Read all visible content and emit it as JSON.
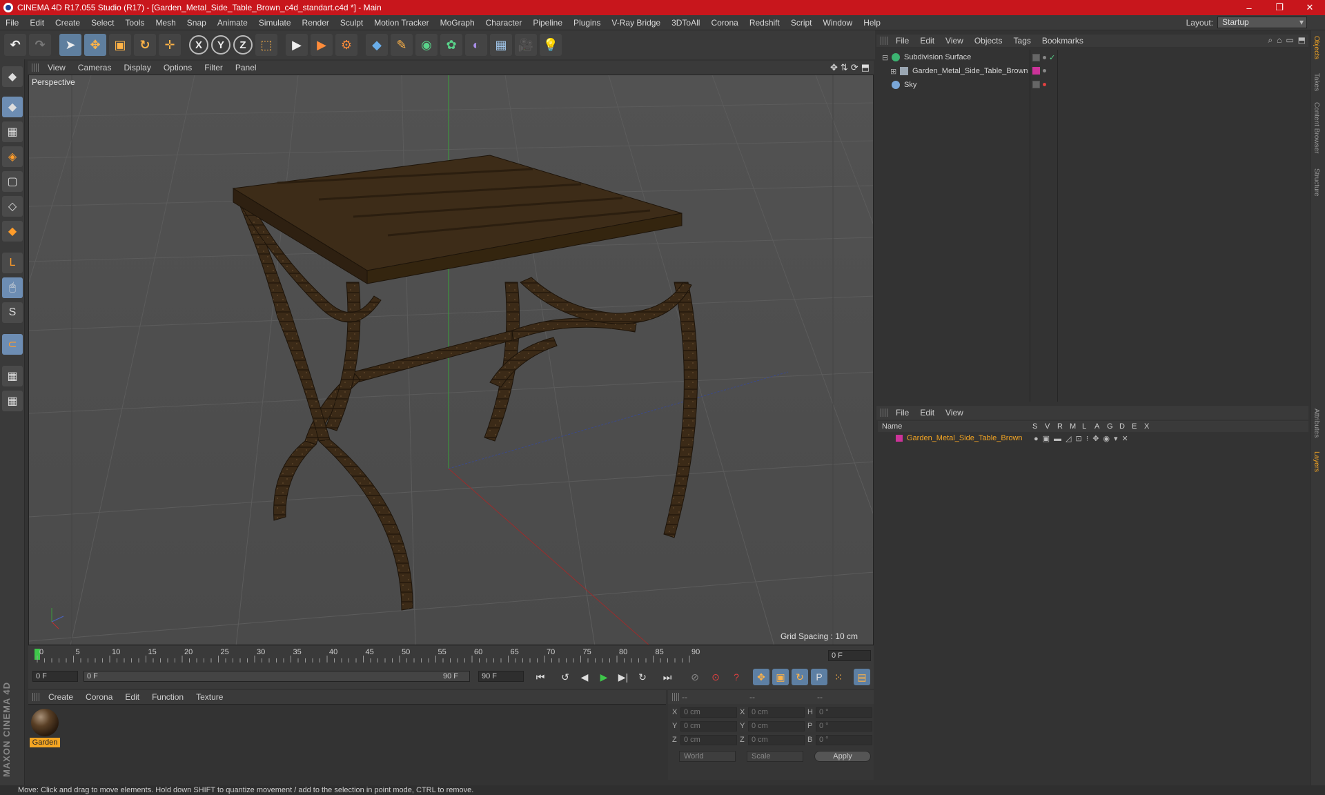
{
  "window": {
    "title": "CINEMA 4D R17.055 Studio (R17) - [Garden_Metal_Side_Table_Brown_c4d_standart.c4d *] - Main",
    "minimize": "–",
    "maximize": "❐",
    "close": "✕"
  },
  "menu": [
    "File",
    "Edit",
    "Create",
    "Select",
    "Tools",
    "Mesh",
    "Snap",
    "Animate",
    "Simulate",
    "Render",
    "Sculpt",
    "Motion Tracker",
    "MoGraph",
    "Character",
    "Pipeline",
    "Plugins",
    "V-Ray Bridge",
    "3DToAll",
    "Corona",
    "Redshift",
    "Script",
    "Window",
    "Help"
  ],
  "layout": {
    "label": "Layout:",
    "value": "Startup"
  },
  "toolbar": {
    "undo": "↶",
    "redo": "↷",
    "select": "➤",
    "move": "✥",
    "scale": "▣",
    "rotate": "↻",
    "move2": "✛",
    "x_lock": "X",
    "y_lock": "Y",
    "z_lock": "Z",
    "coord": "⬚",
    "render_view": "▶",
    "render_pic": "▶",
    "render_settings": "⚙",
    "cube": "◆",
    "pen": "✎",
    "subdiv": "◉",
    "array": "✿",
    "deformer": "◐",
    "floor": "▦",
    "camera": "🎥",
    "light": "💡"
  },
  "viewport": {
    "menu": [
      "View",
      "Cameras",
      "Display",
      "Options",
      "Filter",
      "Panel"
    ],
    "label": "Perspective",
    "grid_spacing": "Grid Spacing : 10 cm",
    "nav_icons": [
      "✥",
      "⇅",
      "⟳",
      "⬒"
    ]
  },
  "timeline": {
    "ticks": [
      "0",
      "5",
      "10",
      "15",
      "20",
      "25",
      "30",
      "35",
      "40",
      "45",
      "50",
      "55",
      "60",
      "65",
      "70",
      "75",
      "80",
      "85",
      "90"
    ],
    "current_frame": "0 F",
    "start": "0 F",
    "range_start": "0 F",
    "range_end": "90 F",
    "end": "90 F"
  },
  "transport": [
    "⏮",
    "↺",
    "◀",
    "▶",
    "▶|",
    "↻",
    "⏭"
  ],
  "material_manager": {
    "menu": [
      "Create",
      "Corona",
      "Edit",
      "Function",
      "Texture"
    ],
    "materials": [
      {
        "name": "Garden"
      }
    ]
  },
  "coordinates": {
    "header": [
      "--",
      "--",
      "--"
    ],
    "rows": [
      {
        "a": "X",
        "av": "0 cm",
        "b": "X",
        "bv": "0 cm",
        "c": "H",
        "cv": "0 °"
      },
      {
        "a": "Y",
        "av": "0 cm",
        "b": "Y",
        "bv": "0 cm",
        "c": "P",
        "cv": "0 °"
      },
      {
        "a": "Z",
        "av": "0 cm",
        "b": "Z",
        "bv": "0 cm",
        "c": "B",
        "cv": "0 °"
      }
    ],
    "space": "World",
    "mode": "Scale",
    "apply": "Apply"
  },
  "object_manager": {
    "menu": [
      "File",
      "Edit",
      "View",
      "Objects",
      "Tags",
      "Bookmarks"
    ],
    "objects": [
      {
        "name": "Subdivision Surface",
        "icon_color": "#3cb371"
      },
      {
        "name": "Garden_Metal_Side_Table_Brown",
        "icon_color": "#9aa6b2"
      },
      {
        "name": "Sky",
        "icon_color": "#7aa7d8"
      }
    ]
  },
  "layer_manager": {
    "menu": [
      "File",
      "Edit",
      "View"
    ],
    "columns": [
      "Name",
      "S",
      "V",
      "R",
      "M",
      "L",
      "A",
      "G",
      "D",
      "E",
      "X"
    ],
    "layers": [
      {
        "name": "Garden_Metal_Side_Table_Brown",
        "color": "#cc3399"
      }
    ]
  },
  "right_tabs": [
    "Objects",
    "Takes",
    "Content Browser",
    "Structure",
    "Attributes",
    "Layers"
  ],
  "left_tools": [
    "◆",
    "▦",
    "◈",
    "▢",
    "◇",
    "◆",
    "L",
    "🖱",
    "S",
    "⊂",
    "▦",
    "▦"
  ],
  "brand": "MAXON CINEMA 4D",
  "status": "Move: Click and drag to move elements. Hold down SHIFT to quantize movement / add to the selection in point mode, CTRL to remove.",
  "colors": {
    "title_bar": "#c8161c",
    "accent": "#f5a623",
    "active_tool": "#5f7f9f"
  }
}
